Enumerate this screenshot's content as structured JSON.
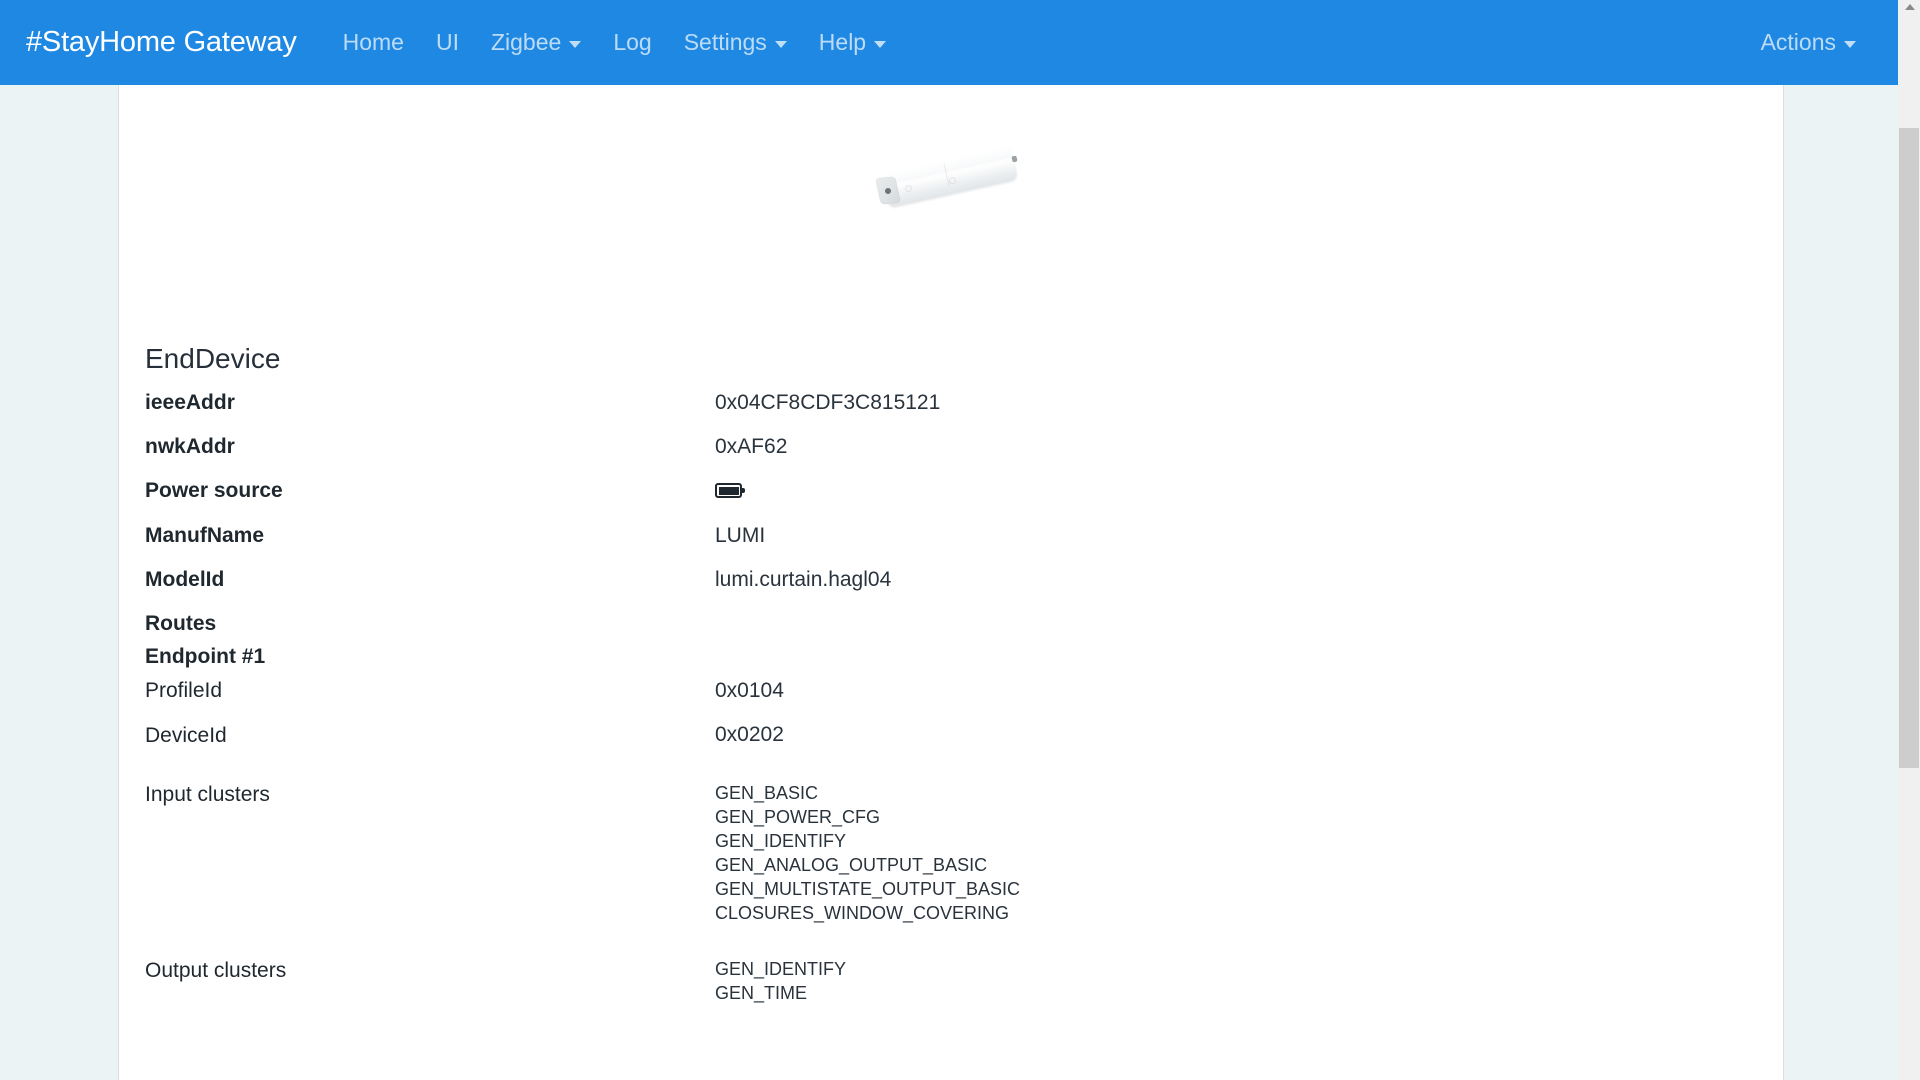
{
  "navbar": {
    "brand": "#StayHome Gateway",
    "brand_color": "#ffffff",
    "background_color": "#1e88e3",
    "items": [
      {
        "label": "Home",
        "has_caret": false
      },
      {
        "label": "UI",
        "has_caret": false
      },
      {
        "label": "Zigbee",
        "has_caret": true
      },
      {
        "label": "Log",
        "has_caret": false
      },
      {
        "label": "Settings",
        "has_caret": true
      },
      {
        "label": "Help",
        "has_caret": true
      }
    ],
    "right_items": [
      {
        "label": "Actions",
        "has_caret": true
      }
    ]
  },
  "device": {
    "image_alt": "curtain-motor-device-photo",
    "title": "EndDevice",
    "properties": [
      {
        "label": "ieeeAddr",
        "bold": true,
        "value": "0x04CF8CDF3C815121",
        "type": "text"
      },
      {
        "label": "nwkAddr",
        "bold": true,
        "value": "0xAF62",
        "type": "text"
      },
      {
        "label": "Power source",
        "bold": true,
        "value": "battery-full-icon",
        "type": "icon"
      },
      {
        "label": "ManufName",
        "bold": true,
        "value": "LUMI",
        "type": "text"
      },
      {
        "label": "ModelId",
        "bold": true,
        "value": "lumi.curtain.hagl04",
        "type": "text"
      },
      {
        "label": "Routes",
        "bold": true,
        "value": "",
        "type": "text"
      },
      {
        "label": "Endpoint #1",
        "bold": true,
        "value": "",
        "type": "text"
      },
      {
        "label": "ProfileId",
        "bold": false,
        "value": "0x0104",
        "type": "text"
      },
      {
        "label": "DeviceId",
        "bold": false,
        "value": "0x0202",
        "type": "text"
      },
      {
        "label": "Input clusters",
        "bold": false,
        "type": "list",
        "items": [
          "GEN_BASIC",
          "GEN_POWER_CFG",
          "GEN_IDENTIFY",
          "GEN_ANALOG_OUTPUT_BASIC",
          "GEN_MULTISTATE_OUTPUT_BASIC",
          "CLOSURES_WINDOW_COVERING"
        ]
      },
      {
        "label": "Output clusters",
        "bold": false,
        "type": "list",
        "items": [
          "GEN_IDENTIFY",
          "GEN_TIME"
        ]
      }
    ]
  },
  "scrollbar": {
    "position": "right",
    "thumb_color": "#cdcdcd",
    "track_color": "#f0f0f0"
  },
  "page": {
    "background_color": "#ebf3f5",
    "container_color": "#ffffff"
  }
}
